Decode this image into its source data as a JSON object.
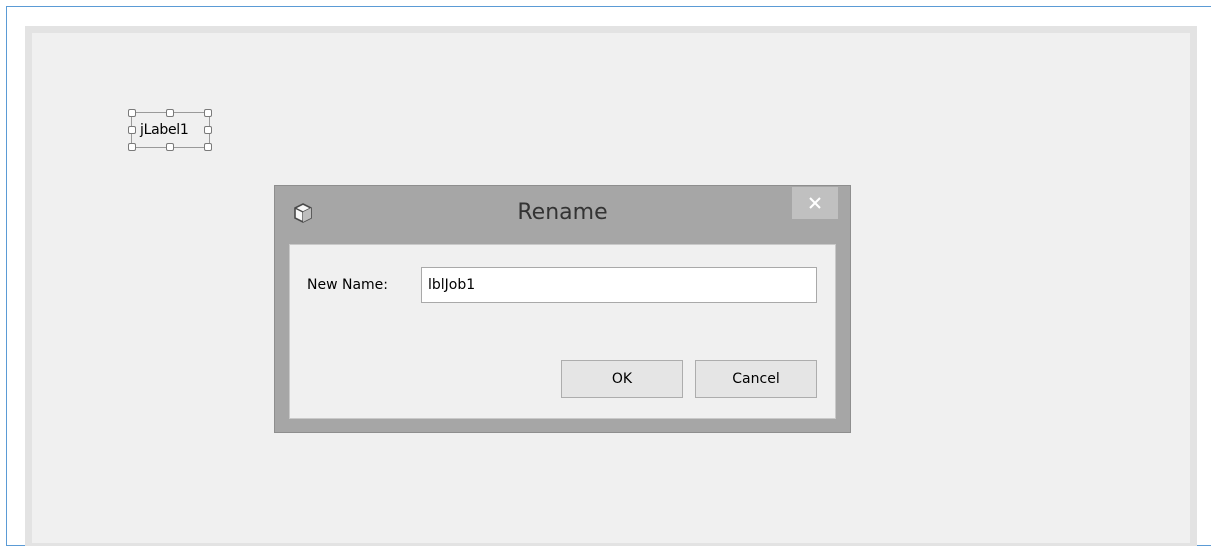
{
  "designer": {
    "selected_component_label": "jLabel1"
  },
  "dialog": {
    "title": "Rename",
    "icon": "app-cube-icon",
    "close_glyph": "×",
    "field_label": "New Name:",
    "field_value": "lblJob1",
    "ok_label": "OK",
    "cancel_label": "Cancel"
  },
  "colors": {
    "frame_border": "#5b9bd5",
    "dialog_frame": "#a6a6a6",
    "close_button": "#c0c0c0",
    "form_background": "#f0f0f0"
  }
}
